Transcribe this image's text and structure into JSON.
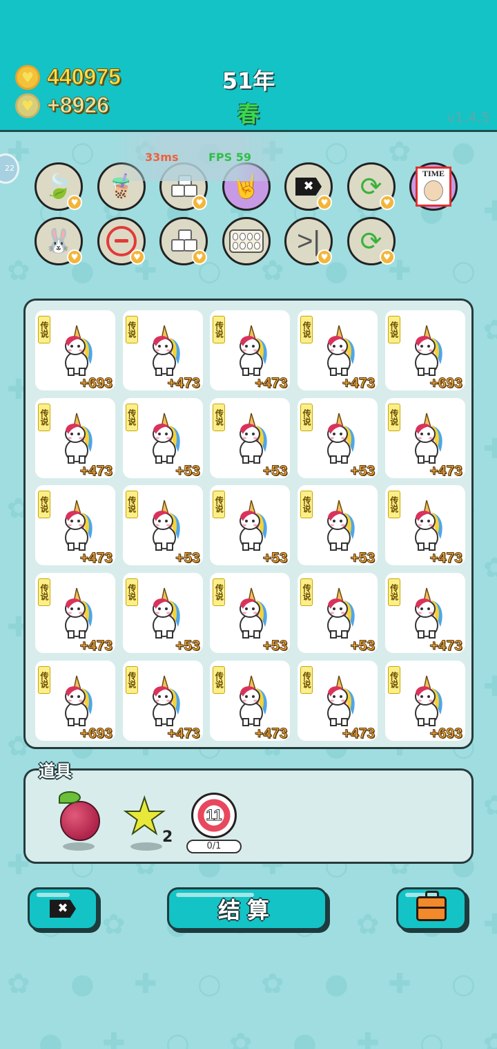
{
  "header": {
    "coins": "440975",
    "income": "+8926",
    "year": "51年",
    "season": "春",
    "version": "v1.4.5"
  },
  "perf": {
    "latency": "33ms",
    "fps": "FPS 59"
  },
  "side_tab": "22",
  "skills_row1": [
    {
      "name": "leaf-icon",
      "glyph": "🍃",
      "badge": true
    },
    {
      "name": "bubble-tea-icon",
      "glyph": "🧋",
      "badge": false
    },
    {
      "name": "cubes-icon",
      "glyph": "",
      "badge": true
    },
    {
      "name": "rock-hand-icon",
      "glyph": "🤘",
      "badge": false,
      "purple": true
    },
    {
      "name": "remove-tag-icon",
      "glyph": "✖",
      "badge": true
    },
    {
      "name": "refresh-icon",
      "glyph": "⟳",
      "badge": true
    },
    {
      "name": "time-magazine-icon",
      "glyph": "TIME",
      "badge": false,
      "purple": true
    }
  ],
  "skills_row2": [
    {
      "name": "bunny-icon",
      "glyph": "🐰",
      "badge": true
    },
    {
      "name": "minus-icon",
      "glyph": "",
      "badge": true
    },
    {
      "name": "cubes-icon",
      "glyph": "",
      "badge": true
    },
    {
      "name": "egg-tray-icon",
      "glyph": "",
      "badge": false
    },
    {
      "name": "skip-icon",
      "glyph": ">|",
      "badge": true
    },
    {
      "name": "refresh-icon",
      "glyph": "⟳",
      "badge": true
    }
  ],
  "board": {
    "rank_label": "传说",
    "rows": [
      [
        "+693",
        "+473",
        "+473",
        "+473",
        "+693"
      ],
      [
        "+473",
        "+53",
        "+53",
        "+53",
        "+473"
      ],
      [
        "+473",
        "+53",
        "+53",
        "+53",
        "+473"
      ],
      [
        "+473",
        "+53",
        "+53",
        "+53",
        "+473"
      ],
      [
        "+693",
        "+473",
        "+473",
        "+473",
        "+693"
      ]
    ]
  },
  "props": {
    "title": "道具",
    "star_count": "2",
    "target_number": "11",
    "target_progress": "0/1"
  },
  "buttons": {
    "settle": "结算"
  }
}
